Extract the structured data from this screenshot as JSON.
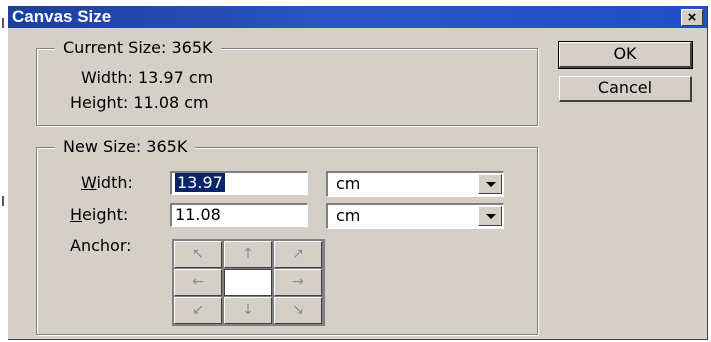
{
  "window": {
    "title": "Canvas Size",
    "close_glyph": "×"
  },
  "current_size": {
    "legend": "Current Size: 365K",
    "width_text": "Width: 13.97 cm",
    "height_text": "Height: 11.08 cm"
  },
  "new_size": {
    "legend": "New Size: 365K",
    "width": {
      "label_access": "W",
      "label_rest": "idth:",
      "value": "13.97",
      "unit": "cm"
    },
    "height": {
      "label_access": "H",
      "label_rest": "eight:",
      "value": "11.08",
      "unit": "cm"
    },
    "anchor_label": "Anchor:",
    "anchor_arrows": [
      "↖",
      "↑",
      "↗",
      "←",
      "",
      "→",
      "↙",
      "↓",
      "↘"
    ]
  },
  "buttons": {
    "ok": "OK",
    "cancel": "Cancel"
  },
  "colors": {
    "titlebar": "#2050c8",
    "dialog": "#d4d0c8",
    "selection": "#0a246a"
  }
}
